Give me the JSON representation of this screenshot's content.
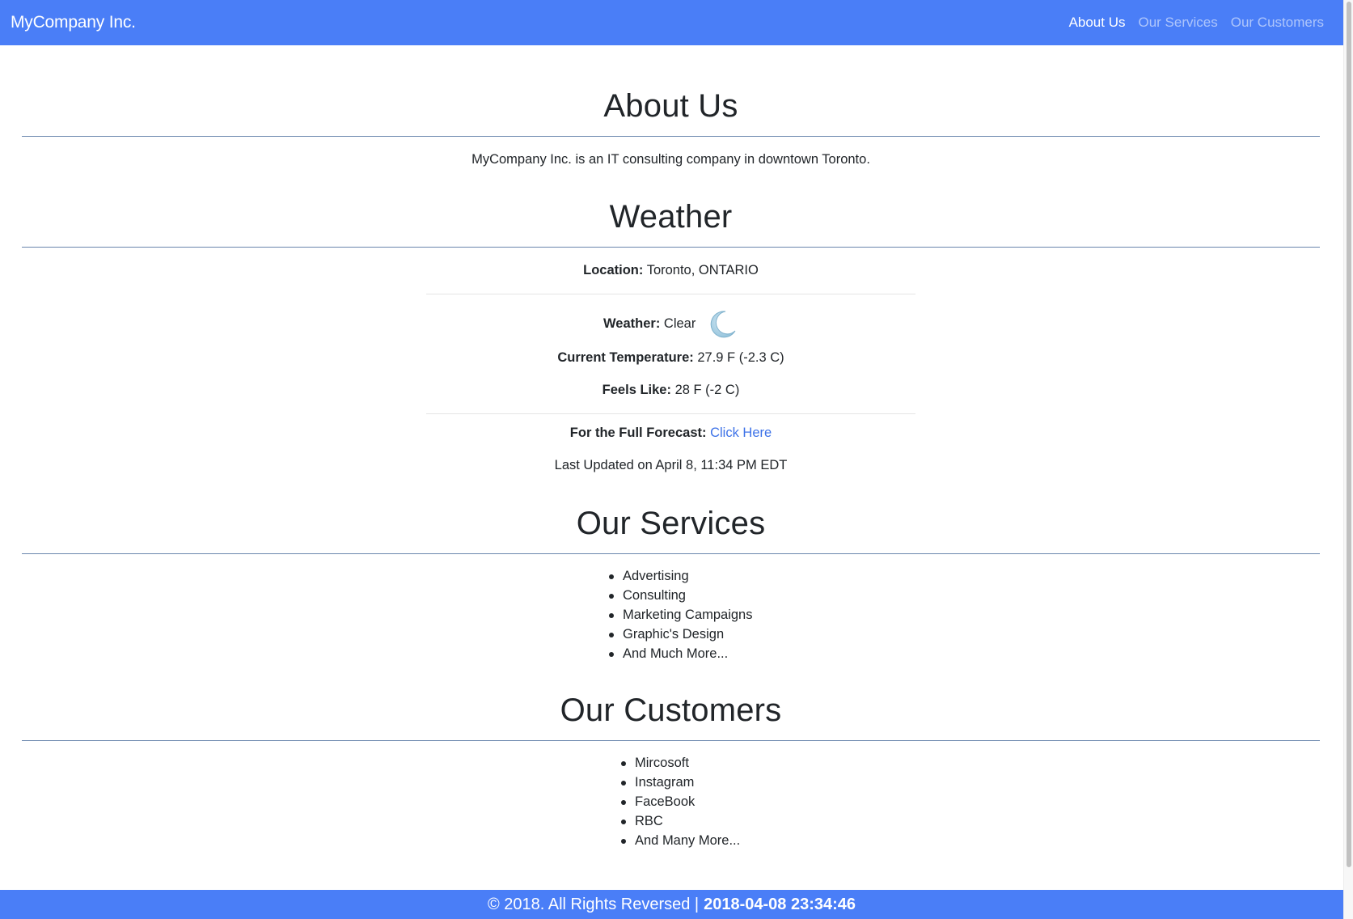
{
  "navbar": {
    "brand": "MyCompany Inc.",
    "links": [
      "About Us",
      "Our Services",
      "Our Customers"
    ]
  },
  "about": {
    "title": "About Us",
    "text": "MyCompany Inc. is an IT consulting company in downtown Toronto."
  },
  "weather": {
    "title": "Weather",
    "location_label": "Location:",
    "location_value": "Toronto, ONTARIO",
    "condition_label": "Weather:",
    "condition_value": "Clear",
    "condition_icon": "moon-icon",
    "temp_label": "Current Temperature:",
    "temp_value": "27.9 F (-2.3 C)",
    "feels_label": "Feels Like:",
    "feels_value": "28 F (-2 C)",
    "forecast_label": "For the Full Forecast:",
    "forecast_link": "Click Here",
    "updated": "Last Updated on April 8, 11:34 PM EDT"
  },
  "services": {
    "title": "Our Services",
    "items": [
      "Advertising",
      "Consulting",
      "Marketing Campaigns",
      "Graphic's Design",
      "And Much More..."
    ]
  },
  "customers": {
    "title": "Our Customers",
    "items": [
      "Mircosoft",
      "Instagram",
      "FaceBook",
      "RBC",
      "And Many More..."
    ]
  },
  "footer": {
    "copyright": "© 2018. All Rights Reversed |",
    "timestamp": "2018-04-08 23:34:46"
  },
  "colors": {
    "accent": "#4a7ef7",
    "link": "#3d72e8",
    "divider": "#6a86ad"
  }
}
